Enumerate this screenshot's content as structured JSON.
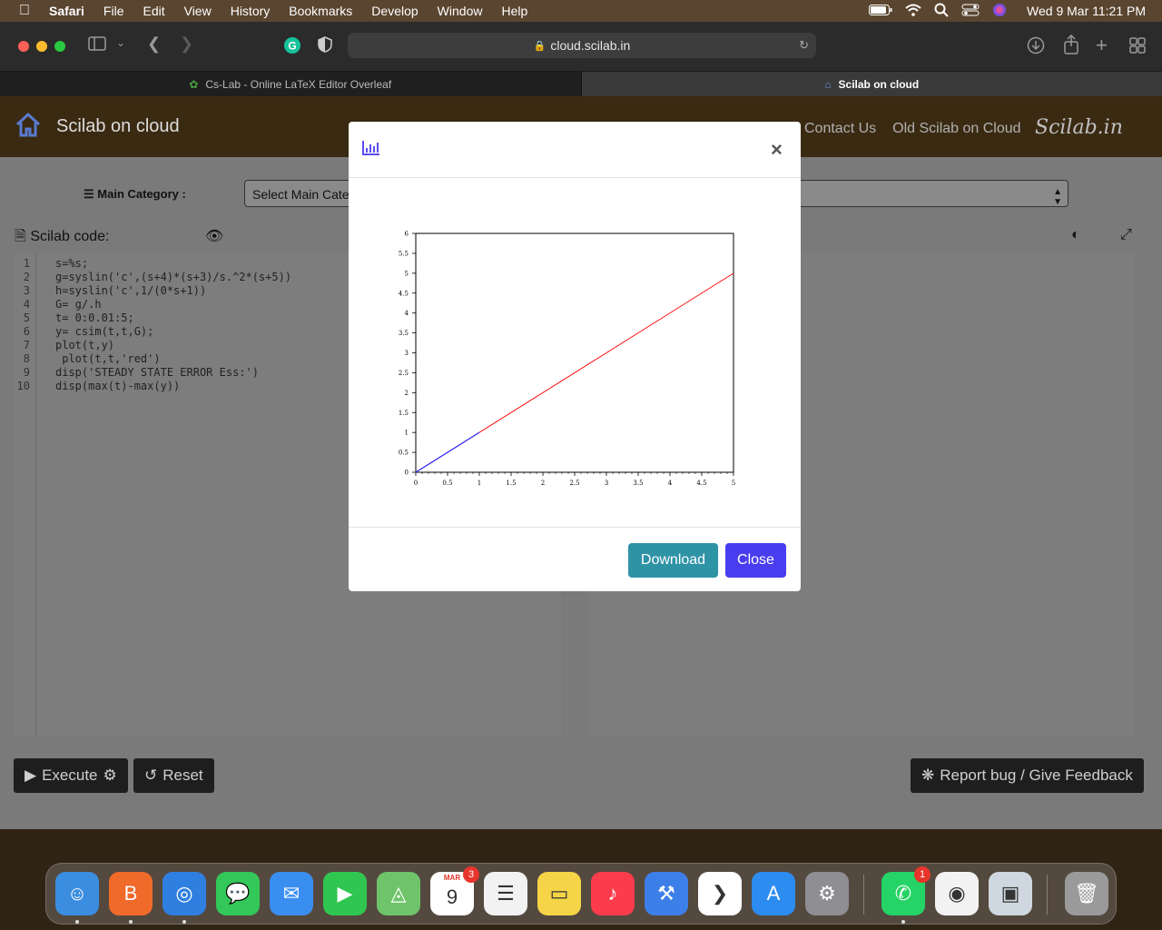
{
  "menubar": {
    "app": "Safari",
    "items": [
      "File",
      "Edit",
      "View",
      "History",
      "Bookmarks",
      "Develop",
      "Window",
      "Help"
    ],
    "clock": "Wed 9 Mar  11:21 PM"
  },
  "browser": {
    "url": "cloud.scilab.in",
    "tabs": [
      {
        "label": "Cs-Lab - Online LaTeX Editor Overleaf"
      },
      {
        "label": "Scilab on cloud"
      }
    ]
  },
  "site": {
    "title": "Scilab on cloud",
    "nav": [
      "Contact Us",
      "Old Scilab on Cloud"
    ],
    "logo": "Scilab.in",
    "main_category_label": "Main Category :",
    "main_category_select": "Select Main Cate",
    "code_label": "Scilab code:",
    "code_lines": [
      {
        "n": "1",
        "t": "s=%s;"
      },
      {
        "n": "2",
        "t": "g=syslin('c',(s+4)*(s+3)/s.^2*(s+5))"
      },
      {
        "n": "3",
        "t": "h=syslin('c',1/(0*s+1))"
      },
      {
        "n": "4",
        "t": "G= g/.h"
      },
      {
        "n": "5",
        "t": "t= 0:0.01:5;"
      },
      {
        "n": "6",
        "t": "y= csim(t,t,G);"
      },
      {
        "n": "7",
        "t": "plot(t,y)"
      },
      {
        "n": "8",
        "t": " plot(t,t,'red')"
      },
      {
        "n": "9",
        "t": "disp('STEADY STATE ERROR Ess:')"
      },
      {
        "n": "10",
        "t": "disp(max(t)-max(y))"
      }
    ],
    "execute_label": "Execute",
    "reset_label": "Reset",
    "report_label": "Report bug / Give Feedback"
  },
  "modal": {
    "download_label": "Download",
    "close_label": "Close",
    "close_icon": "×"
  },
  "chart_data": {
    "type": "line",
    "xlim": [
      0,
      5
    ],
    "ylim": [
      0,
      6
    ],
    "xticks": [
      "0",
      "0.5",
      "1",
      "1.5",
      "2",
      "2.5",
      "3",
      "3.5",
      "4",
      "4.5",
      "5"
    ],
    "yticks": [
      "0",
      "0.5",
      "1",
      "1.5",
      "2",
      "2.5",
      "3",
      "3.5",
      "4",
      "4.5",
      "5",
      "5.5",
      "6"
    ],
    "series": [
      {
        "color": "#ff0000",
        "x": [
          0,
          5
        ],
        "y": [
          0,
          5
        ]
      },
      {
        "color": "#2a2aff",
        "x": [
          0,
          0.5,
          1
        ],
        "y": [
          0,
          0.5,
          1
        ]
      }
    ],
    "grid": false
  },
  "dock": {
    "items": [
      {
        "name": "finder",
        "icon": "☺",
        "color": "#3b8de0"
      },
      {
        "name": "brave",
        "icon": "B",
        "color": "#f06a2a"
      },
      {
        "name": "safari",
        "icon": "◎",
        "color": "#2f7fe0"
      },
      {
        "name": "messages",
        "icon": "💬",
        "color": "#34c759"
      },
      {
        "name": "mail",
        "icon": "✉",
        "color": "#3a8ef0"
      },
      {
        "name": "facetime",
        "icon": "▶",
        "color": "#30c750"
      },
      {
        "name": "maps",
        "icon": "◬",
        "color": "#6fc36a"
      },
      {
        "name": "calendar",
        "icon": "9",
        "color": "#ffffff",
        "badge": "3",
        "sub": "MAR"
      },
      {
        "name": "reminders",
        "icon": "☰",
        "color": "#f2f2f2"
      },
      {
        "name": "notes",
        "icon": "▭",
        "color": "#f5d547"
      },
      {
        "name": "music",
        "icon": "♪",
        "color": "#fa3c4c"
      },
      {
        "name": "xcode",
        "icon": "⚒",
        "color": "#3d7fe8"
      },
      {
        "name": "vscode",
        "icon": "❯",
        "color": "#ffffff"
      },
      {
        "name": "appstore",
        "icon": "A",
        "color": "#2d8cf0"
      },
      {
        "name": "system-preferences",
        "icon": "⚙",
        "color": "#8e8e93"
      },
      {
        "name": "whatsapp",
        "icon": "✆",
        "color": "#25d366",
        "badge": "1"
      },
      {
        "name": "chrome",
        "icon": "◉",
        "color": "#f2f2f2"
      },
      {
        "name": "preview",
        "icon": "▣",
        "color": "#cfd8e0"
      },
      {
        "name": "trash",
        "icon": "🗑",
        "color": "#9a9a9a"
      }
    ]
  }
}
